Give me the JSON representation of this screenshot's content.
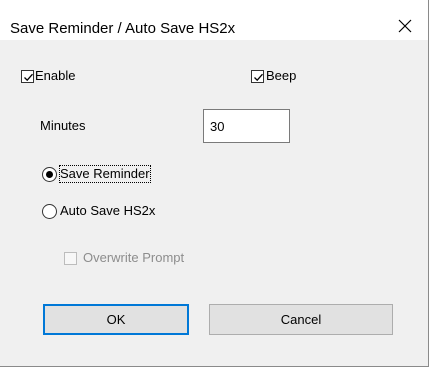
{
  "window": {
    "title": "Save Reminder / Auto Save HS2x"
  },
  "options": {
    "enable_label": "Enable",
    "enable_checked": true,
    "beep_label": "Beep",
    "beep_checked": true
  },
  "minutes": {
    "label": "Minutes",
    "value": "30"
  },
  "mode": {
    "save_reminder_label": "Save Reminder",
    "auto_save_label": "Auto Save HS2x",
    "selected": "save_reminder"
  },
  "overwrite": {
    "label": "Overwrite Prompt",
    "checked": false,
    "enabled": false
  },
  "buttons": {
    "ok_label": "OK",
    "cancel_label": "Cancel"
  },
  "colors": {
    "accent": "#0078d7",
    "dialog_bg": "#f0f0f0",
    "button_bg": "#e1e1e1",
    "disabled_text": "#8d8d8d"
  }
}
